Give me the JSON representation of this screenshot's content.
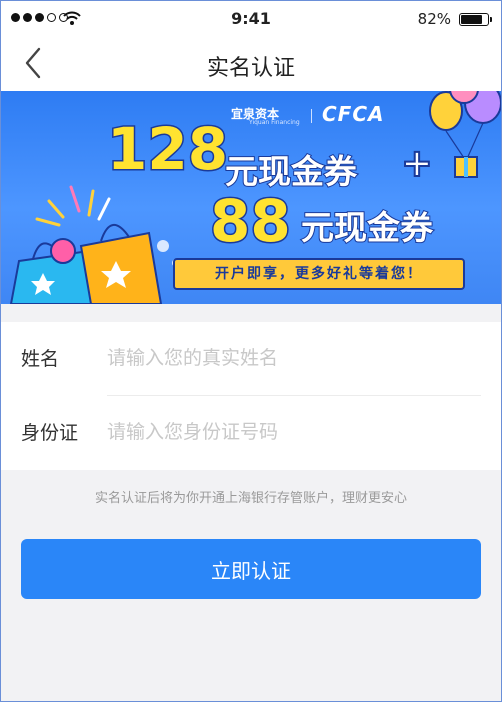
{
  "status_bar": {
    "time": "9:41",
    "battery": "82%",
    "battery_level": 0.82
  },
  "nav": {
    "title": "实名认证"
  },
  "banner": {
    "brand_cn": "宜泉资本",
    "brand_en": "Yiquan Financing",
    "partner": "CFCA",
    "amount1": "128",
    "voucher1": "元现金券",
    "plus": "+",
    "amount2": "88",
    "voucher2": "元现金券",
    "ribbon": "开户即享，更多好礼等着您！"
  },
  "form": {
    "name_label": "姓名",
    "name_placeholder": "请输入您的真实姓名",
    "id_label": "身份证",
    "id_placeholder": "请输入您身份证号码"
  },
  "hint": "实名认证后将为你开通上海银行存管账户，理财更安心",
  "submit_label": "立即认证",
  "colors": {
    "accent": "#2a86f8",
    "banner": "#3f86f4",
    "gold": "#ffe330"
  }
}
